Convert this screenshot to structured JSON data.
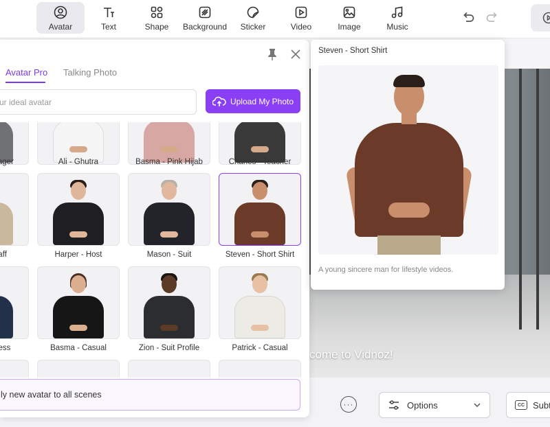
{
  "toolbar": {
    "tools": [
      {
        "label": "Avatar",
        "icon": "avatar-icon",
        "active": true
      },
      {
        "label": "Text",
        "icon": "text-icon",
        "active": false
      },
      {
        "label": "Shape",
        "icon": "shape-icon",
        "active": false
      },
      {
        "label": "Background",
        "icon": "background-icon",
        "active": false
      },
      {
        "label": "Sticker",
        "icon": "sticker-icon",
        "active": false
      },
      {
        "label": "Video",
        "icon": "video-icon",
        "active": false
      },
      {
        "label": "Image",
        "icon": "image-icon",
        "active": false
      },
      {
        "label": "Music",
        "icon": "music-icon",
        "active": false
      }
    ]
  },
  "panel": {
    "tabs": [
      {
        "label": "Avatar Pro",
        "active": true
      },
      {
        "label": "Talking Photo",
        "active": false
      }
    ],
    "search_placeholder": "ur ideal avatar",
    "upload_label": "Upload My Photo",
    "avatars": [
      {
        "name": "anager"
      },
      {
        "name": "Ali - Ghutra"
      },
      {
        "name": "Basma - Pink Hijab"
      },
      {
        "name": "Charles - Teacher"
      },
      {
        "name": "taff"
      },
      {
        "name": "Harper - Host"
      },
      {
        "name": "Mason - Suit"
      },
      {
        "name": "Steven - Short Shirt",
        "selected": true
      },
      {
        "name": "iness"
      },
      {
        "name": "Basma - Casual"
      },
      {
        "name": "Zion - Suit Profile"
      },
      {
        "name": "Patrick - Casual"
      }
    ],
    "apply_label": "ly new avatar to all scenes"
  },
  "preview": {
    "title": "Steven - Short Shirt",
    "description": "A young sincere man for lifestyle videos."
  },
  "canvas": {
    "caption": "come to Vidnoz!"
  },
  "bottom": {
    "options_label": "Options",
    "subtitle_label": "Subt"
  },
  "colors": {
    "accent": "#8b3ff5",
    "tab_active": "#7c3aed"
  }
}
